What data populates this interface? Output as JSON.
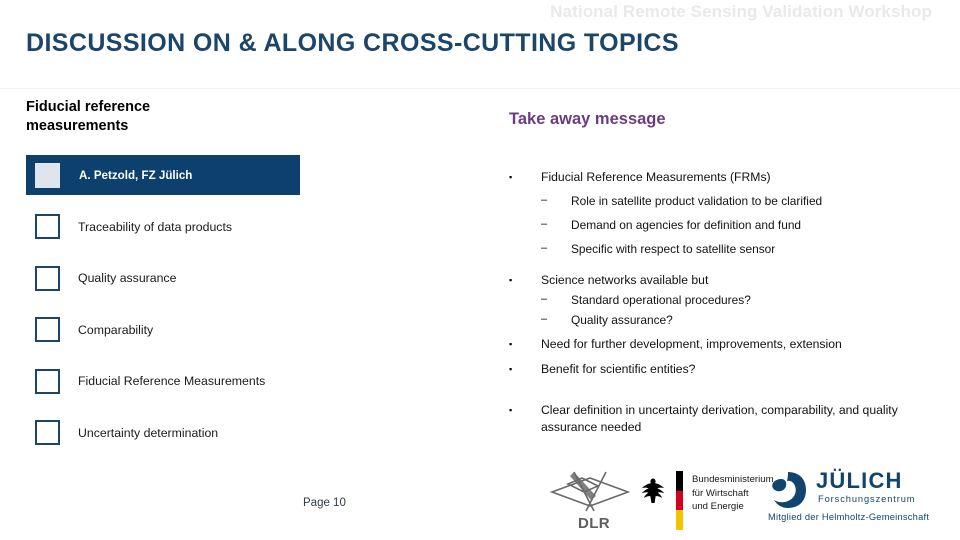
{
  "header": {
    "workshop_banner": "National Remote Sensing Validation Workshop",
    "slide_title": "DISCUSSION ON & ALONG CROSS-CUTTING TOPICS"
  },
  "left": {
    "heading": "Fiducial reference measurements",
    "topics": [
      {
        "label": "A. Petzold, FZ Jülich",
        "active": true
      },
      {
        "label": "Traceability of data products",
        "active": false
      },
      {
        "label": "Quality assurance",
        "active": false
      },
      {
        "label": "Comparability",
        "active": false
      },
      {
        "label": "Fiducial Reference Measurements",
        "active": false
      },
      {
        "label": "Uncertainty determination",
        "active": false
      }
    ]
  },
  "right": {
    "heading": "Take away message",
    "bullet_mark": "▪",
    "dash_mark": "–",
    "items": [
      {
        "level": 1,
        "text": "Fiducial Reference Measurements (FRMs)"
      },
      {
        "level": 2,
        "text": "Role in satellite product validation to be clarified"
      },
      {
        "level": 2,
        "text": "Demand on agencies for definition and fund"
      },
      {
        "level": 2,
        "text": "Specific with respect to satellite sensor"
      },
      {
        "level": 1,
        "text": "Science networks available but"
      },
      {
        "level": 2,
        "text": "Standard operational procedures?"
      },
      {
        "level": 2,
        "text": "Quality assurance?"
      },
      {
        "level": 1,
        "text": "Need for further development, improvements, extension"
      },
      {
        "level": 1,
        "text": "Benefit for scientific entities?"
      },
      {
        "level": 1,
        "text": "Clear definition in uncertainty derivation, comparability, and quality assurance needed"
      }
    ]
  },
  "footer": {
    "page_label": "Page 10",
    "logos": {
      "dlr": {
        "wordmark": "DLR"
      },
      "bmwi": {
        "line1": "Bundesministerium",
        "line2": "für Wirtschaft",
        "line3": "und Energie"
      },
      "juelich": {
        "wordmark": "JÜLICH",
        "subtitle": "Forschungszentrum",
        "membership": "Mitglied der Helmholtz-Gemeinschaft"
      }
    }
  },
  "colors": {
    "navy": "#0e406e",
    "title_navy": "#1b4569",
    "purple": "#6b3c82",
    "banner_gray": "#e9e9ea",
    "dlr_gray": "#5e5e5e",
    "flag_black": "#000000",
    "flag_red": "#d4021d",
    "flag_gold": "#f5c400"
  }
}
